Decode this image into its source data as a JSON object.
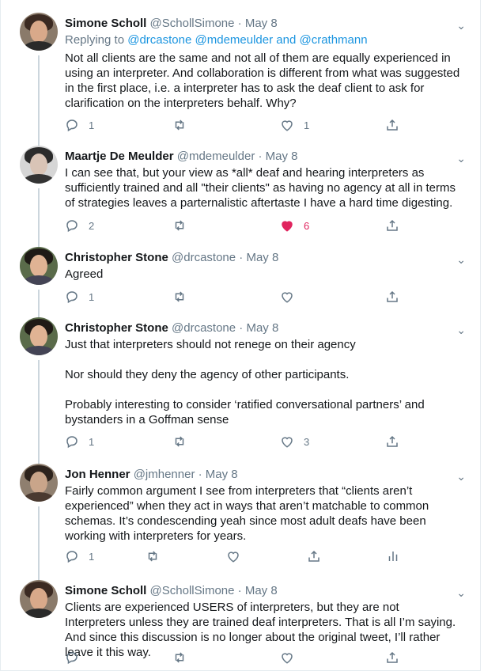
{
  "tweets": [
    {
      "name": "Simone Scholl",
      "handle": "@SchollSimone",
      "date": "May 8",
      "replying_prefix": "Replying to",
      "mentions": [
        "@drcastone",
        "@mdemeulder",
        "and",
        "@crathmann"
      ],
      "text": [
        "Not all clients are the same and not all of them are equally experienced in using an interpreter. And collaboration is different from what was suggested in the first place, i.e. a interpreter has to ask the deaf client to ask for clarification on the interpreters behalf. Why?"
      ],
      "reply_count": "1",
      "retweet_count": "",
      "like_count": "1",
      "liked": false
    },
    {
      "name": "Maartje De Meulder",
      "handle": "@mdemeulder",
      "date": "May 8",
      "text": [
        "I can see that, but your view as *all* deaf and hearing interpreters as sufficiently trained and all \"their clients\" as having no agency at all in terms of strategies leaves a parternalistic aftertaste I have a hard time digesting."
      ],
      "reply_count": "2",
      "retweet_count": "",
      "like_count": "6",
      "liked": true
    },
    {
      "name": "Christopher Stone",
      "handle": "@drcastone",
      "date": "May 8",
      "text": [
        "Agreed"
      ],
      "reply_count": "1",
      "retweet_count": "",
      "like_count": "",
      "liked": false
    },
    {
      "name": "Christopher Stone",
      "handle": "@drcastone",
      "date": "May 8",
      "text": [
        "Just that interpreters should not renege on their agency",
        "Nor should they deny the agency of other participants.",
        "Probably interesting to consider ‘ratified conversational partners’ and bystanders in a Goffman sense"
      ],
      "reply_count": "1",
      "retweet_count": "",
      "like_count": "3",
      "liked": false
    },
    {
      "name": "Jon Henner",
      "handle": "@jmhenner",
      "date": "May 8",
      "text": [
        "Fairly common argument I see from interpreters that “clients aren’t experienced” when they act in ways that aren’t matchable to common schemas. It’s condescending yeah since most adult deafs have been working with interpreters for years."
      ],
      "reply_count": "1",
      "retweet_count": "",
      "like_count": "",
      "liked": false
    },
    {
      "name": "Simone Scholl",
      "handle": "@SchollSimone",
      "date": "May 8",
      "text": [
        "Clients are experienced USERS of interpreters, but they are not Interpreters unless they are trained deaf interpreters. That is all I’m saying. And since this discussion is no longer about the original tweet, I’ll rather leave it this way."
      ],
      "reply_count": "",
      "retweet_count": "",
      "like_count": "",
      "liked": false
    }
  ],
  "separator": "·",
  "colors": {
    "accent": "#1b95e0",
    "muted": "#657786",
    "like": "#e0245e",
    "thread": "#ccd6dd"
  }
}
